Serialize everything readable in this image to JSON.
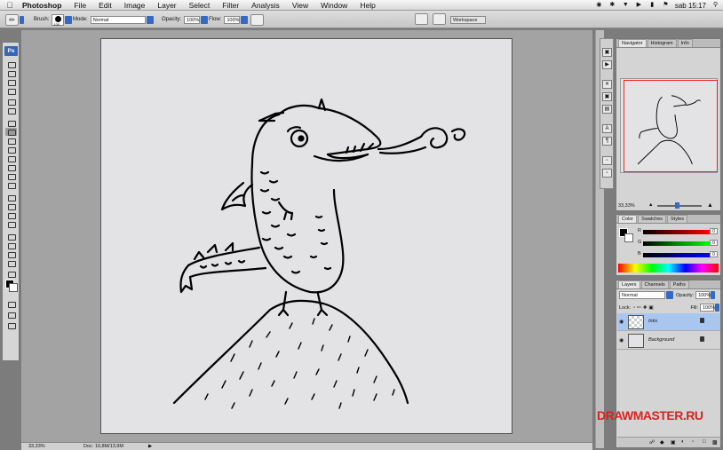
{
  "menubar": {
    "app_name": "Photoshop",
    "items": [
      "File",
      "Edit",
      "Image",
      "Layer",
      "Select",
      "Filter",
      "Analysis",
      "View",
      "Window",
      "Help"
    ],
    "clock": "sab 15:17"
  },
  "options": {
    "brush_label": "Brush:",
    "brush_size": "100",
    "mode_label": "Mode:",
    "mode_value": "Normal",
    "opacity_label": "Opacity:",
    "opacity_value": "100%",
    "flow_label": "Flow:",
    "flow_value": "100%",
    "workspace_label": "Workspace"
  },
  "toolbox": {
    "logo": "Ps"
  },
  "status": {
    "zoom": "33,33%",
    "doc_info": "Doc: 10,8M/13,9M"
  },
  "navigator": {
    "tabs": [
      "Navigator",
      "Histogram",
      "Info"
    ],
    "zoom": "33,33%"
  },
  "color_panel": {
    "tabs": [
      "Color",
      "Swatches",
      "Styles"
    ],
    "channels": [
      {
        "label": "R",
        "value": "0"
      },
      {
        "label": "G",
        "value": "0"
      },
      {
        "label": "B",
        "value": "0"
      }
    ]
  },
  "layers_panel": {
    "tabs": [
      "Layers",
      "Channels",
      "Paths"
    ],
    "blend_mode": "Normal",
    "opacity_label": "Opacity:",
    "opacity_value": "100%",
    "lock_label": "Lock:",
    "fill_label": "Fill:",
    "fill_value": "100%",
    "layers": [
      {
        "name": "Inks",
        "selected": true
      },
      {
        "name": "Background",
        "selected": false
      }
    ]
  },
  "watermark": {
    "text": "DRAWMASTER.RU"
  }
}
